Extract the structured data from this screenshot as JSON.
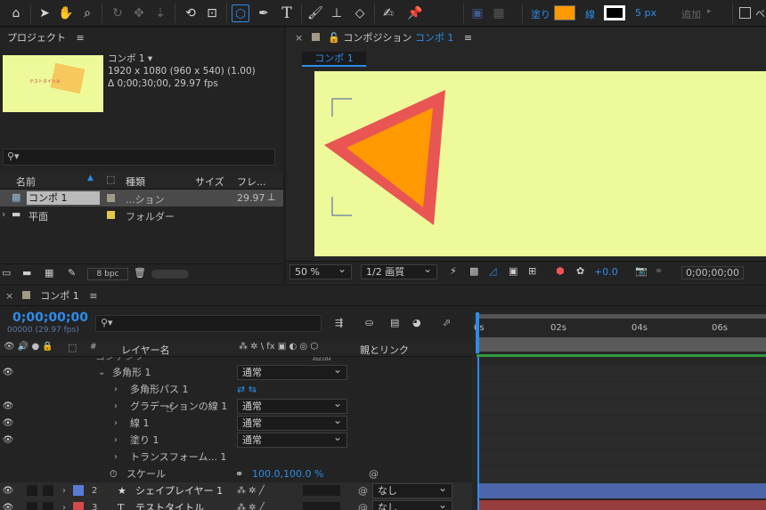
{
  "toolbar": {
    "fill_label": "塗り",
    "fill_color": "#ff9900",
    "stroke_label": "線",
    "stroke_width": "5 px",
    "add_label": "追加",
    "checkbox_label": "ベ"
  },
  "project": {
    "title": "プロジェクト",
    "menu_icon": "≡",
    "comp_name": "コンポ 1 ▾",
    "comp_size": "1920 x 1080  (960 x 540) (1.00)",
    "comp_duration": "Δ 0;00;30;00, 29.97 fps",
    "thumb_text": "テストタイトル",
    "search_placeholder": "",
    "columns": [
      "名前",
      "種類",
      "サイズ",
      "フレ..."
    ],
    "items": [
      {
        "name": "コンポ 1",
        "type": "...ション",
        "fps": "29.97",
        "color": "#a39a86"
      },
      {
        "name": "平面",
        "type": "フォルダー",
        "fps": "",
        "color": "#e8c84a"
      }
    ],
    "bpc": "8 bpc"
  },
  "composition": {
    "title": "コンポジション",
    "title_active": "コンポ 1",
    "tab": "コンポ 1",
    "zoom": "50 %",
    "quality": "1/2 画質",
    "exposure": "+0.0",
    "timecode": "0;00;00;00",
    "bg_color": "#eef99a"
  },
  "timeline": {
    "tab": "コンポ 1",
    "timecode": "0;00;00;00",
    "frames": "00000 (29.97 fps)",
    "col_layer_name": "レイヤー名",
    "col_parent": "親とリンク",
    "col_hash": "#",
    "ruler": [
      "0s",
      "02s",
      "04s",
      "06s"
    ],
    "partial_top_left": "コンテンツ",
    "partial_top_right": "追加",
    "rows": [
      {
        "label": "多角形 1",
        "mode": "通常"
      },
      {
        "label": "多角形パス 1"
      },
      {
        "label": "グラデーションの線 1",
        "mode": "通常"
      },
      {
        "label": "線 1",
        "mode": "通常"
      },
      {
        "label": "塗り 1",
        "mode": "通常"
      },
      {
        "label": "トランスフォーム... 1"
      },
      {
        "label": "スケール",
        "value": "100.0,100.0 %"
      }
    ],
    "layers": [
      {
        "num": "2",
        "name": "シェイプレイヤー 1",
        "parent": "なし",
        "color": "#5b7bd5"
      },
      {
        "num": "3",
        "name": "テストタイトル",
        "parent": "なし",
        "color": "#d54a4a"
      }
    ]
  }
}
